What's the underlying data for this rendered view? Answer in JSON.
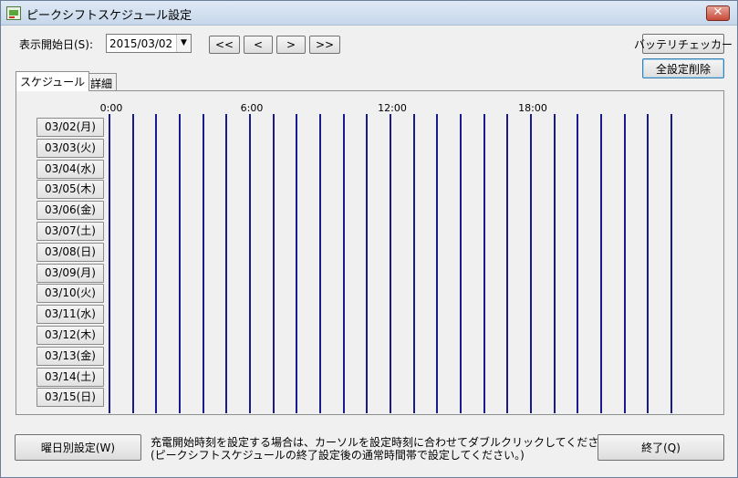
{
  "window": {
    "title": "ピークシフトスケジュール設定",
    "close_glyph": "✕"
  },
  "toolbar": {
    "start_date_label": "表示開始日(S):",
    "start_date_value": "2015/03/02",
    "combo_arrow": "▼",
    "nav": [
      "<<",
      "<",
      ">",
      ">>"
    ],
    "battery_checker_label": "バッテリチェッカー",
    "delete_all_label": "全設定削除"
  },
  "tabs": [
    {
      "label": "スケジュール",
      "active": true
    },
    {
      "label": "詳細",
      "active": false
    }
  ],
  "schedule": {
    "hour_labels": [
      "0:00",
      "6:00",
      "12:00",
      "18:00"
    ],
    "days": [
      "03/02(月)",
      "03/03(火)",
      "03/04(水)",
      "03/05(木)",
      "03/06(金)",
      "03/07(土)",
      "03/08(日)",
      "03/09(月)",
      "03/10(火)",
      "03/11(水)",
      "03/12(木)",
      "03/13(金)",
      "03/14(土)",
      "03/15(日)"
    ]
  },
  "footer": {
    "weekday_settings_label": "曜日別設定(W)",
    "info_line1": "充電開始時刻を設定する場合は、カーソルを設定時刻に合わせてダブルクリックしてください。",
    "info_line2": "(ピークシフトスケジュールの終了設定後の通常時間帯で設定してください。)",
    "exit_label": "終了(Q)"
  }
}
